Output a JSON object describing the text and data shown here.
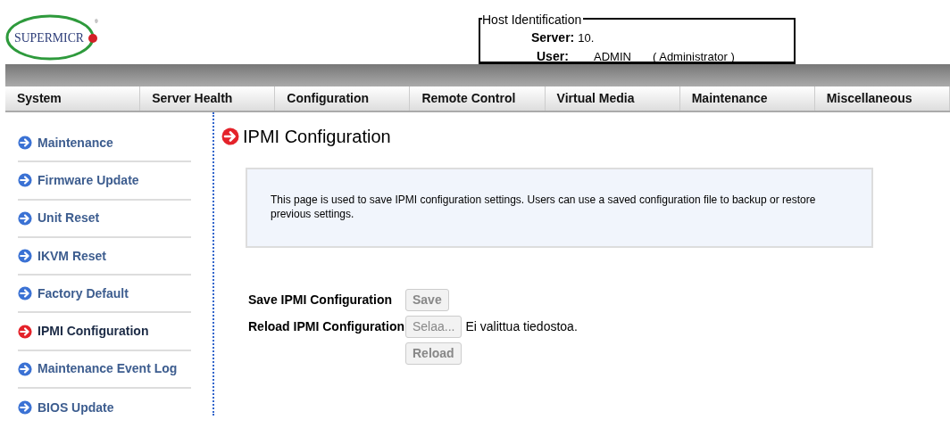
{
  "logo": {
    "text": "SUPERMICR",
    "mark": "®"
  },
  "host_identification": {
    "title": "Host Identification",
    "server_label": "Server:",
    "server_value": "10.",
    "user_label": "User:",
    "user_value": "ADMIN",
    "user_role": "( Administrator )"
  },
  "menu": [
    {
      "label": "System",
      "selected": false
    },
    {
      "label": "Server Health",
      "selected": false
    },
    {
      "label": "Configuration",
      "selected": false
    },
    {
      "label": "Remote Control",
      "selected": false
    },
    {
      "label": "Virtual Media",
      "selected": false
    },
    {
      "label": "Maintenance",
      "selected": false
    },
    {
      "label": "Miscellaneous",
      "selected": false
    }
  ],
  "sidebar": {
    "items": [
      {
        "label": "Maintenance",
        "selected": false
      },
      {
        "label": "Firmware Update",
        "selected": false
      },
      {
        "label": "Unit Reset",
        "selected": false
      },
      {
        "label": "IKVM Reset",
        "selected": false
      },
      {
        "label": "Factory Default",
        "selected": false
      },
      {
        "label": "IPMI Configuration",
        "selected": true
      },
      {
        "label": "Maintenance Event Log",
        "selected": false
      },
      {
        "label": "BIOS Update",
        "selected": false
      }
    ]
  },
  "page": {
    "title": "IPMI Configuration",
    "description": "This page is used to save IPMI configuration settings. Users can use a saved configuration file to backup or restore previous settings.",
    "save_label": "Save IPMI Configuration",
    "save_button": {
      "label": "Save",
      "disabled": true
    },
    "reload_label": "Reload IPMI Configuration",
    "browse_button": {
      "label": "Selaa...",
      "disabled": true
    },
    "file_status": "Ei valittua tiedostoa.",
    "reload_button": {
      "label": "Reload",
      "disabled": true
    }
  }
}
